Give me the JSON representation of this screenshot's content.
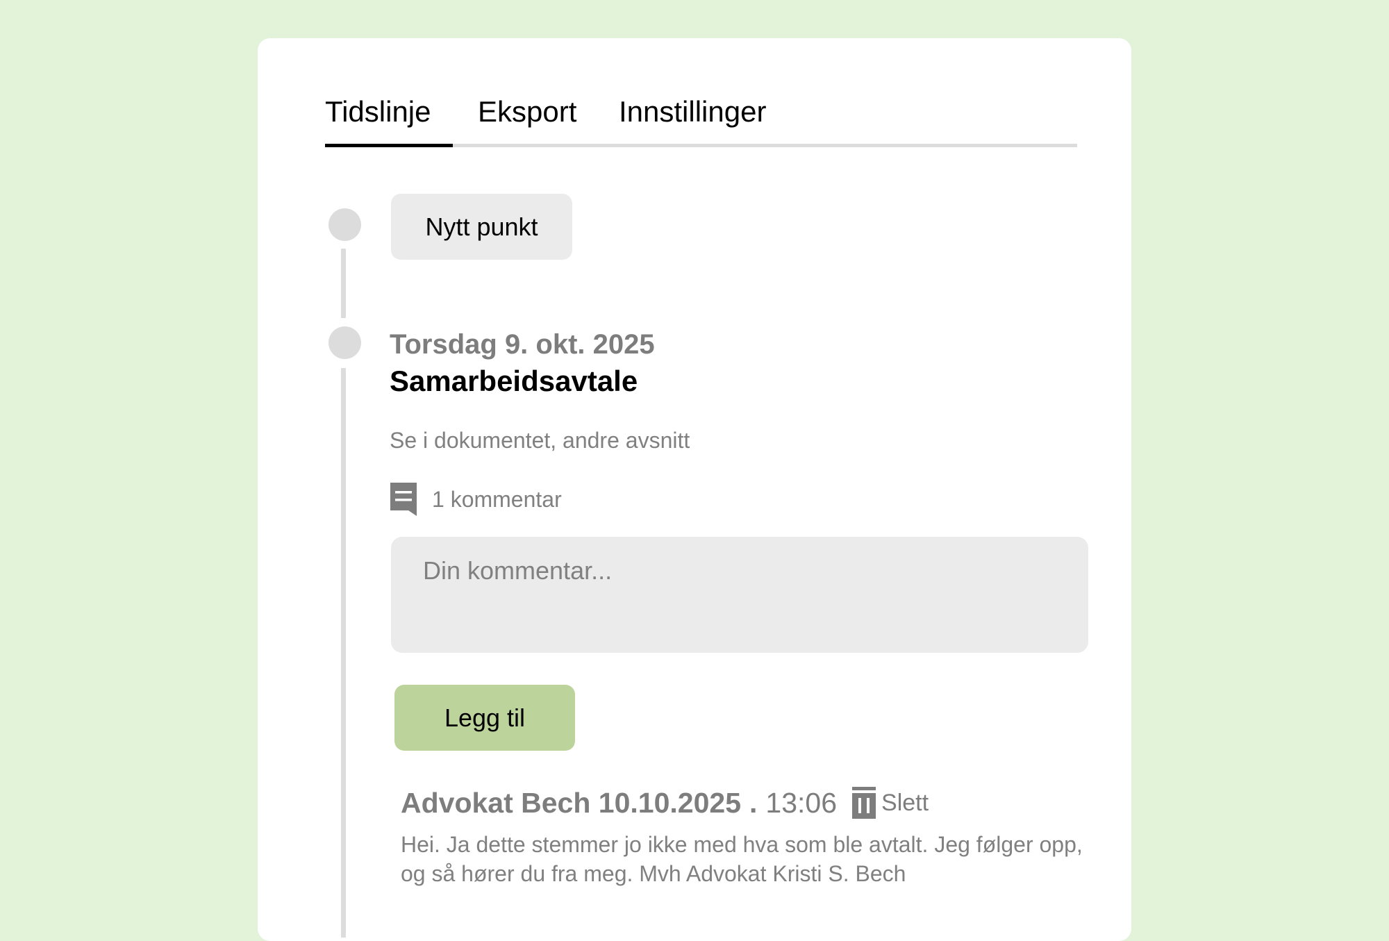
{
  "tabs": [
    {
      "label": "Tidslinje",
      "active": true
    },
    {
      "label": "Eksport",
      "active": false
    },
    {
      "label": "Innstillinger",
      "active": false
    }
  ],
  "timeline": {
    "new_point_label": "Nytt punkt",
    "entry": {
      "date": "Torsdag 9. okt. 2025",
      "title": "Samarbeidsavtale",
      "description": "Se i dokumentet, andre avsnitt",
      "comment_count_label": "1 kommentar",
      "comment_placeholder": "Din kommentar...",
      "add_button_label": "Legg til",
      "comments": [
        {
          "author": "Advokat Bech 10.10.2025",
          "separator": ".",
          "time": "13:06",
          "delete_label": "Slett",
          "text": "Hei. Ja dette stemmer jo ikke med hva som ble avtalt. Jeg følger opp, og så hører du fra meg. Mvh Advokat Kristi S. Bech"
        }
      ]
    }
  },
  "colors": {
    "background": "#e2f3d9",
    "card": "#ffffff",
    "accent_button": "#bdd39c",
    "muted_text": "#808080",
    "timeline": "#dcdcdc"
  },
  "icons": {
    "comment": "comment-icon",
    "delete": "trash-icon"
  }
}
